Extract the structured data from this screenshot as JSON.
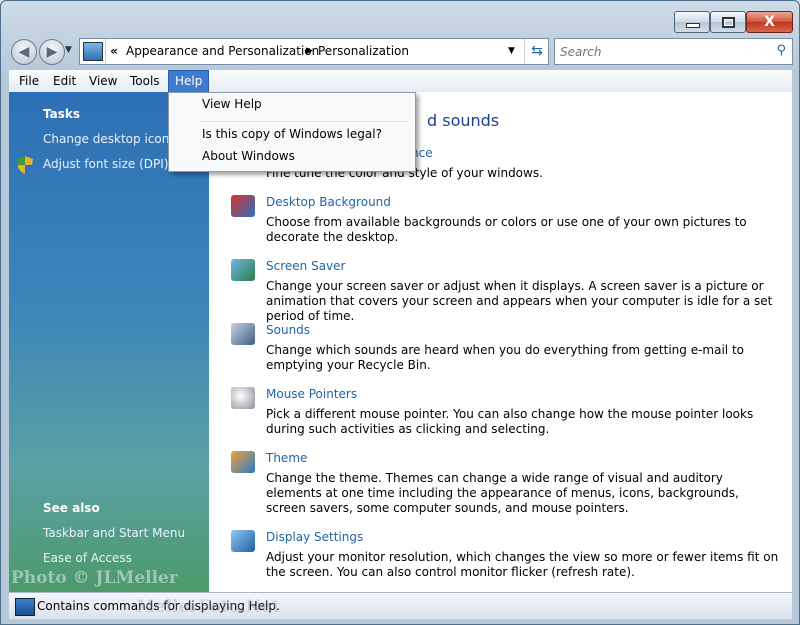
{
  "titlebar": {
    "close_label": "X"
  },
  "address": {
    "overflow": "«",
    "breadcrumb": [
      "Appearance and Personalization",
      "Personalization"
    ]
  },
  "search": {
    "placeholder": "Search"
  },
  "menubar": [
    "File",
    "Edit",
    "View",
    "Tools",
    "Help"
  ],
  "help_menu": [
    "View Help",
    "Is this copy of Windows legal?",
    "About Windows"
  ],
  "left_pane": {
    "tasks_heading": "Tasks",
    "tasks": [
      "Change desktop icons",
      "Adjust font size (DPI)"
    ],
    "see_also_heading": "See also",
    "see_also": [
      "Taskbar and Start Menu",
      "Ease of Access"
    ]
  },
  "content": {
    "title_partial": "d sounds",
    "first_link_partial": "nce",
    "first_desc": "Fine tune the color and style of your windows.",
    "items": [
      {
        "title": "Desktop Background",
        "desc": "Choose from available backgrounds or colors or use one of your own pictures to decorate the desktop.",
        "icon": "desktop-background-icon"
      },
      {
        "title": "Screen Saver",
        "desc": "Change your screen saver or adjust when it displays. A screen saver is a picture or animation that covers your screen and appears when your computer is idle for a set period of time.",
        "icon": "screen-saver-icon"
      },
      {
        "title": "Sounds",
        "desc": "Change which sounds are heard when you do everything from getting e-mail to emptying your Recycle Bin.",
        "icon": "sounds-icon"
      },
      {
        "title": "Mouse Pointers",
        "desc": "Pick a different mouse pointer. You can also change how the mouse pointer looks during such activities as clicking and selecting.",
        "icon": "mouse-pointer-icon"
      },
      {
        "title": "Theme",
        "desc": "Change the theme. Themes can change a wide range of visual and auditory elements at one time including the appearance of menus, icons, backgrounds, screen savers, some computer sounds, and mouse pointers.",
        "icon": "theme-icon"
      },
      {
        "title": "Display Settings",
        "desc": "Adjust your monitor resolution, which changes the view so more or fewer items fit on the screen. You can also control monitor flicker (refresh rate).",
        "icon": "display-settings-icon"
      }
    ]
  },
  "statusbar": {
    "text": "Contains commands for displaying Help."
  },
  "watermark": {
    "line1": "Photo © JLMeller",
    "line2": "MellerFoto.Net"
  }
}
